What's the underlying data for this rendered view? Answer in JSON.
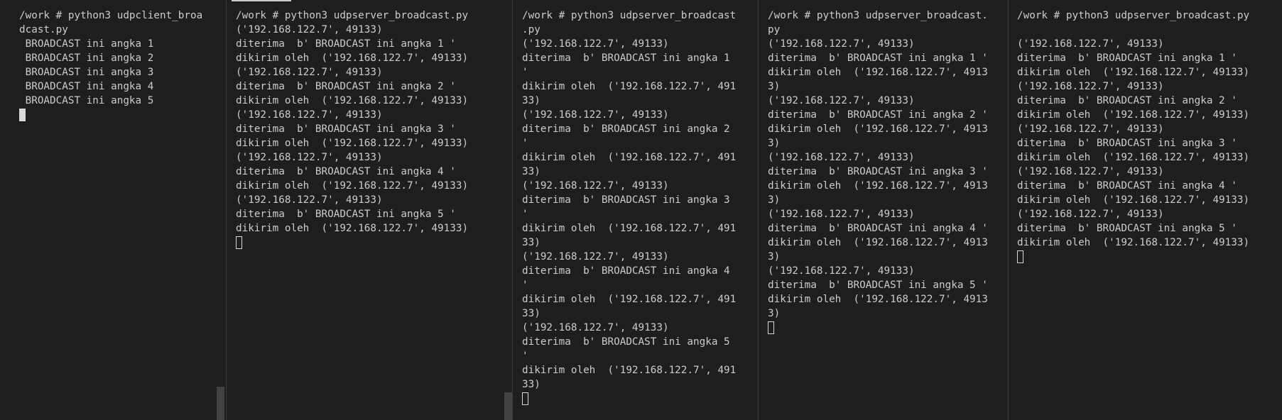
{
  "panes": [
    {
      "lines": [
        "/work # python3 udpclient_broa",
        "dcast.py",
        " BROADCAST ini angka 1",
        " BROADCAST ini angka 2",
        " BROADCAST ini angka 3",
        " BROADCAST ini angka 4",
        " BROADCAST ini angka 5"
      ]
    },
    {
      "lines": [
        "/work # python3 udpserver_broadcast.py",
        "('192.168.122.7', 49133)",
        "diterima  b' BROADCAST ini angka 1 '",
        "dikirim oleh  ('192.168.122.7', 49133)",
        "('192.168.122.7', 49133)",
        "diterima  b' BROADCAST ini angka 2 '",
        "dikirim oleh  ('192.168.122.7', 49133)",
        "('192.168.122.7', 49133)",
        "diterima  b' BROADCAST ini angka 3 '",
        "dikirim oleh  ('192.168.122.7', 49133)",
        "('192.168.122.7', 49133)",
        "diterima  b' BROADCAST ini angka 4 '",
        "dikirim oleh  ('192.168.122.7', 49133)",
        "('192.168.122.7', 49133)",
        "diterima  b' BROADCAST ini angka 5 '",
        "dikirim oleh  ('192.168.122.7', 49133)"
      ]
    },
    {
      "lines": [
        "/work # python3 udpserver_broadcast",
        ".py",
        "('192.168.122.7', 49133)",
        "diterima  b' BROADCAST ini angka 1",
        "'",
        "dikirim oleh  ('192.168.122.7', 491",
        "33)",
        "('192.168.122.7', 49133)",
        "diterima  b' BROADCAST ini angka 2",
        "'",
        "dikirim oleh  ('192.168.122.7', 491",
        "33)",
        "('192.168.122.7', 49133)",
        "diterima  b' BROADCAST ini angka 3",
        "'",
        "dikirim oleh  ('192.168.122.7', 491",
        "33)",
        "('192.168.122.7', 49133)",
        "diterima  b' BROADCAST ini angka 4",
        "'",
        "dikirim oleh  ('192.168.122.7', 491",
        "33)",
        "('192.168.122.7', 49133)",
        "diterima  b' BROADCAST ini angka 5",
        "'",
        "dikirim oleh  ('192.168.122.7', 491",
        "33)"
      ]
    },
    {
      "lines": [
        "/work # python3 udpserver_broadcast.",
        "py",
        "('192.168.122.7', 49133)",
        "diterima  b' BROADCAST ini angka 1 '",
        "dikirim oleh  ('192.168.122.7', 4913",
        "3)",
        "('192.168.122.7', 49133)",
        "diterima  b' BROADCAST ini angka 2 '",
        "dikirim oleh  ('192.168.122.7', 4913",
        "3)",
        "('192.168.122.7', 49133)",
        "diterima  b' BROADCAST ini angka 3 '",
        "dikirim oleh  ('192.168.122.7', 4913",
        "3)",
        "('192.168.122.7', 49133)",
        "diterima  b' BROADCAST ini angka 4 '",
        "dikirim oleh  ('192.168.122.7', 4913",
        "3)",
        "('192.168.122.7', 49133)",
        "diterima  b' BROADCAST ini angka 5 '",
        "dikirim oleh  ('192.168.122.7', 4913",
        "3)"
      ]
    },
    {
      "lines": [
        "/work # python3 udpserver_broadcast.py",
        "",
        "('192.168.122.7', 49133)",
        "diterima  b' BROADCAST ini angka 1 '",
        "dikirim oleh  ('192.168.122.7', 49133)",
        "('192.168.122.7', 49133)",
        "diterima  b' BROADCAST ini angka 2 '",
        "dikirim oleh  ('192.168.122.7', 49133)",
        "('192.168.122.7', 49133)",
        "diterima  b' BROADCAST ini angka 3 '",
        "dikirim oleh  ('192.168.122.7', 49133)",
        "('192.168.122.7', 49133)",
        "diterima  b' BROADCAST ini angka 4 '",
        "dikirim oleh  ('192.168.122.7', 49133)",
        "('192.168.122.7', 49133)",
        "diterima  b' BROADCAST ini angka 5 '",
        "dikirim oleh  ('192.168.122.7', 49133)"
      ]
    }
  ],
  "colors": {
    "background": "#1e1e1e",
    "text": "#cccccc",
    "divider": "#3c3c3c",
    "cursor": "#d9d9d9",
    "scrollbar": "#424242"
  }
}
